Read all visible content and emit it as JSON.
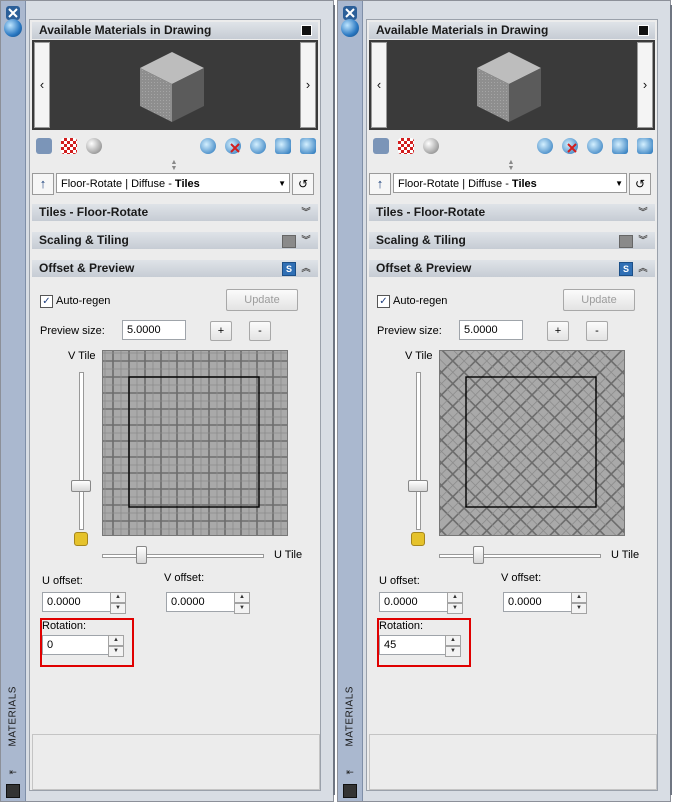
{
  "panels": [
    {
      "side_title": "MATERIALS",
      "available_title": "Available Materials in Drawing",
      "material": {
        "prefix": "Floor-Rotate | Diffuse - ",
        "bold": "Tiles"
      },
      "sections": {
        "tiles": "Tiles - Floor-Rotate",
        "scaling": "Scaling & Tiling",
        "offset": "Offset & Preview"
      },
      "auto_regen_label": "Auto-regen",
      "auto_regen_checked": "✓",
      "update_label": "Update",
      "preview_size_label": "Preview size:",
      "preview_size_value": "5.0000",
      "plus_label": "+",
      "minus_label": "-",
      "v_tile_label": "V Tile",
      "u_tile_label": "U Tile",
      "u_offset_label": "U offset:",
      "u_offset_value": "0.0000",
      "v_offset_label": "V offset:",
      "v_offset_value": "0.0000",
      "rotation_label": "Rotation:",
      "rotation_value": "0",
      "grid_rotation_deg": 0
    },
    {
      "side_title": "MATERIALS",
      "available_title": "Available Materials in Drawing",
      "material": {
        "prefix": "Floor-Rotate | Diffuse - ",
        "bold": "Tiles"
      },
      "sections": {
        "tiles": "Tiles - Floor-Rotate",
        "scaling": "Scaling & Tiling",
        "offset": "Offset & Preview"
      },
      "auto_regen_label": "Auto-regen",
      "auto_regen_checked": "✓",
      "update_label": "Update",
      "preview_size_label": "Preview size:",
      "preview_size_value": "5.0000",
      "plus_label": "+",
      "minus_label": "-",
      "v_tile_label": "V Tile",
      "u_tile_label": "U Tile",
      "u_offset_label": "U offset:",
      "u_offset_value": "0.0000",
      "v_offset_label": "V offset:",
      "v_offset_value": "0.0000",
      "rotation_label": "Rotation:",
      "rotation_value": "45",
      "grid_rotation_deg": 45
    }
  ],
  "nav": {
    "prev": "‹",
    "next": "›"
  },
  "icons": [
    "create-material-icon",
    "checker-map-icon",
    "sphere-swatch-icon",
    "purge-icon",
    "delete-icon",
    "apply-icon",
    "remove-icon",
    "select-objects-icon"
  ],
  "colors": {
    "highlight_red": "#e00000",
    "header_bg": "#c6ccd4",
    "preview_bg": "#3a3a3a"
  }
}
